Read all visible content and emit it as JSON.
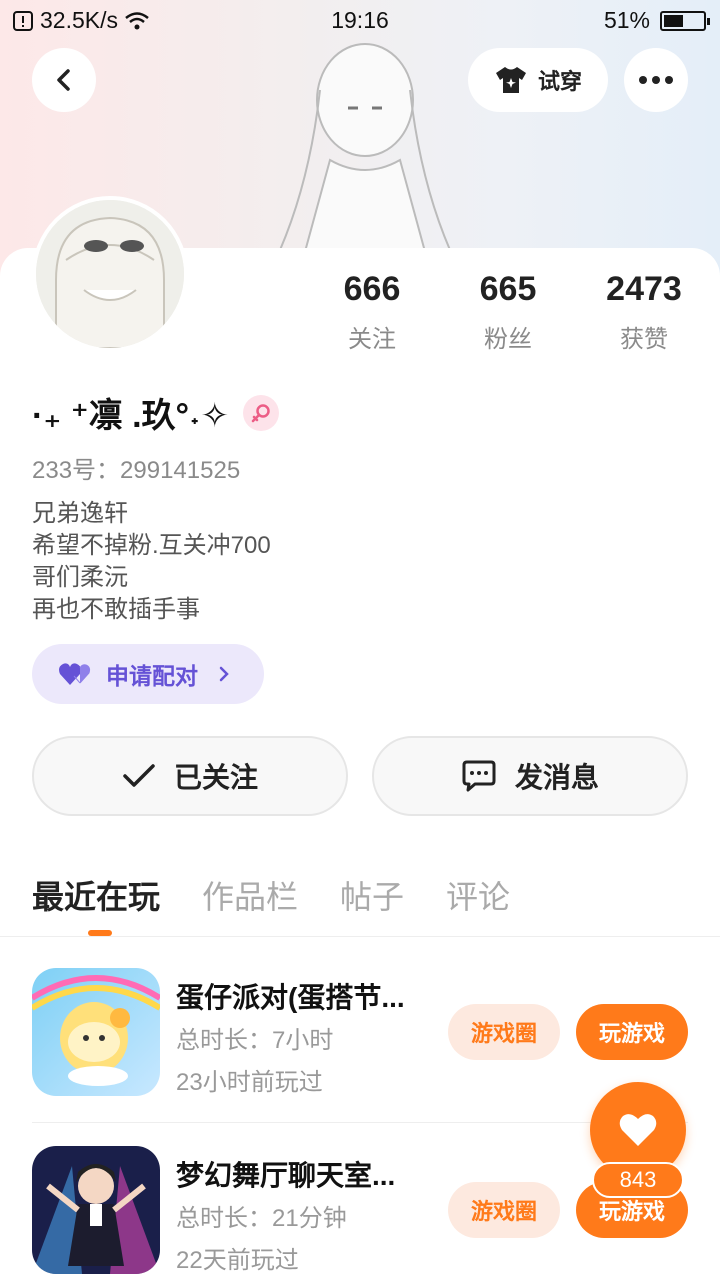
{
  "status_bar": {
    "net_speed": "32.5K/s",
    "time": "19:16",
    "battery_percent": "51%",
    "battery_level": 0.51
  },
  "header": {
    "try_on_label": "试穿"
  },
  "profile": {
    "nickname": "·₊ ⁺凛 .玖°˖✧",
    "uid_text": "233号：299141525",
    "bio": [
      "兄弟逸轩",
      "希望不掉粉.互关冲700",
      "哥们柔沅",
      "再也不敢插手事"
    ],
    "stats": [
      {
        "value": "666",
        "label": "关注"
      },
      {
        "value": "665",
        "label": "粉丝"
      },
      {
        "value": "2473",
        "label": "获赞"
      }
    ],
    "pair_label": "申请配对"
  },
  "actions": {
    "followed_label": "已关注",
    "message_label": "发消息"
  },
  "tabs": [
    {
      "label": "最近在玩",
      "active": true
    },
    {
      "label": "作品栏",
      "active": false
    },
    {
      "label": "帖子",
      "active": false
    },
    {
      "label": "评论",
      "active": false
    }
  ],
  "games": [
    {
      "title": "蛋仔派对(蛋搭节...",
      "duration": "总时长：7小时",
      "last_played": "23小时前玩过",
      "circle_label": "游戏圈",
      "play_label": "玩游戏"
    },
    {
      "title": "梦幻舞厅聊天室...",
      "duration": "总时长：21分钟",
      "last_played": "22天前玩过",
      "circle_label": "游戏圈",
      "play_label": "玩游戏"
    }
  ],
  "like_fab": {
    "count": "843"
  },
  "colors": {
    "accent": "#ff7a1a",
    "pair_purple": "#6552d6"
  }
}
